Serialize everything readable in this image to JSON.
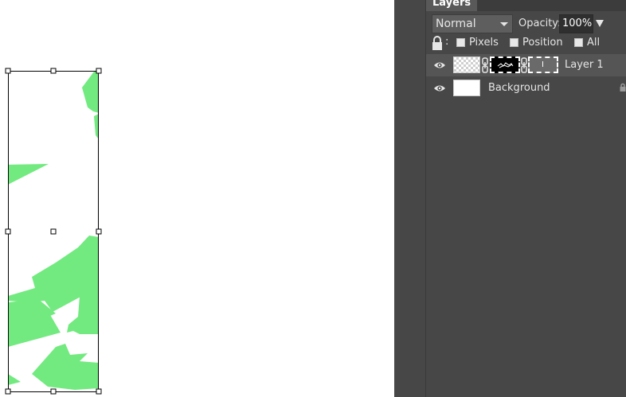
{
  "panel": {
    "tab_title": "Layers",
    "blend_mode": "Normal",
    "opacity_label": "Opacity:",
    "opacity_value": "100%",
    "lock_colon": ":",
    "lock_options": [
      {
        "label": "Pixels",
        "checked": false
      },
      {
        "label": "Position",
        "checked": false
      },
      {
        "label": "All",
        "checked": false
      }
    ]
  },
  "layers": [
    {
      "name": "Layer 1",
      "visible": true,
      "selected": true,
      "has_mask": true,
      "has_vector_mask": true
    },
    {
      "name": "Background",
      "visible": true,
      "selected": false,
      "locked": true
    }
  ],
  "colors": {
    "panel_bg": "#474747",
    "selected_row": "#555555",
    "shape_fill": "#72ea80",
    "canvas_bg": "#ffffff"
  },
  "icons": {
    "visibility": "eye-icon",
    "lock": "lock-icon",
    "link": "chain-icon",
    "dropdown": "chevron-down-icon"
  }
}
